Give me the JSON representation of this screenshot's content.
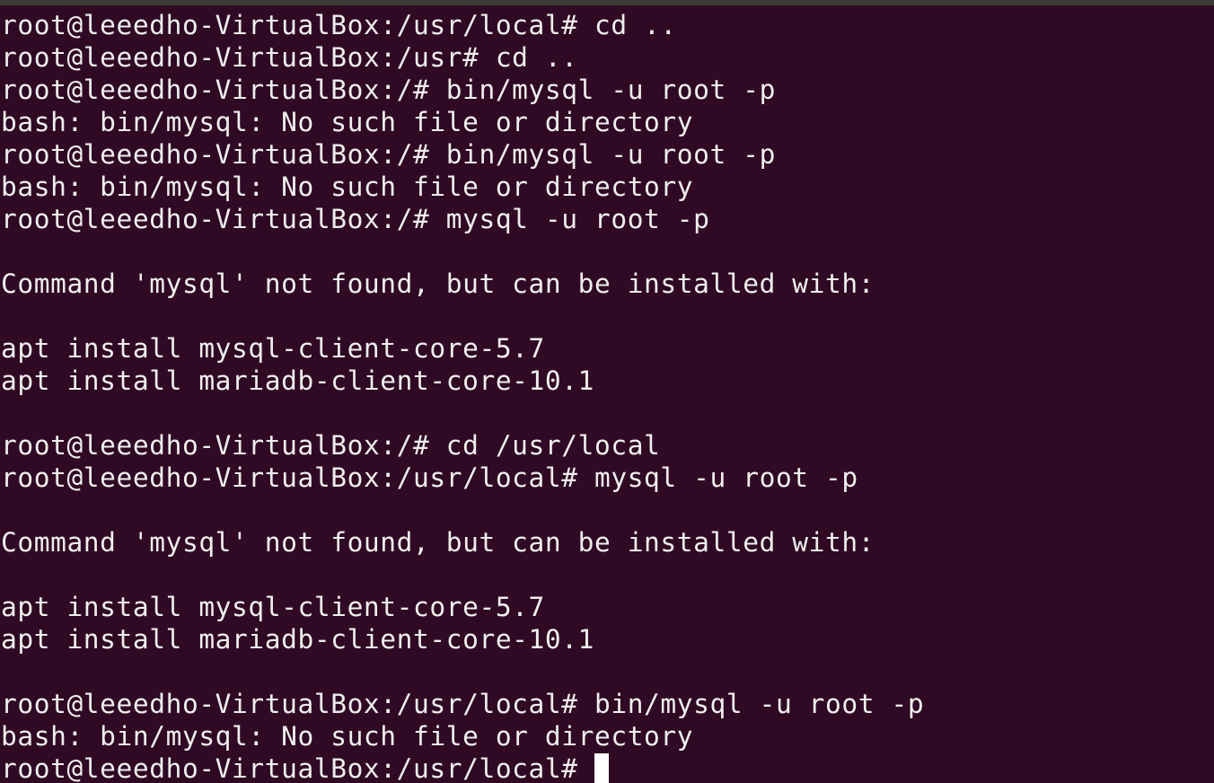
{
  "terminal": {
    "lines": [
      "root@leeedho-VirtualBox:/usr/local# cd ..",
      "root@leeedho-VirtualBox:/usr# cd ..",
      "root@leeedho-VirtualBox:/# bin/mysql -u root -p",
      "bash: bin/mysql: No such file or directory",
      "root@leeedho-VirtualBox:/# bin/mysql -u root -p",
      "bash: bin/mysql: No such file or directory",
      "root@leeedho-VirtualBox:/# mysql -u root -p",
      "",
      "Command 'mysql' not found, but can be installed with:",
      "",
      "apt install mysql-client-core-5.7",
      "apt install mariadb-client-core-10.1",
      "",
      "root@leeedho-VirtualBox:/# cd /usr/local",
      "root@leeedho-VirtualBox:/usr/local# mysql -u root -p",
      "",
      "Command 'mysql' not found, but can be installed with:",
      "",
      "apt install mysql-client-core-5.7",
      "apt install mariadb-client-core-10.1",
      "",
      "root@leeedho-VirtualBox:/usr/local# bin/mysql -u root -p",
      "bash: bin/mysql: No such file or directory"
    ],
    "prompt": "root@leeedho-VirtualBox:/usr/local# "
  },
  "colors": {
    "background": "#300a24",
    "foreground": "#eeeeec",
    "cursor": "#ffffff"
  }
}
